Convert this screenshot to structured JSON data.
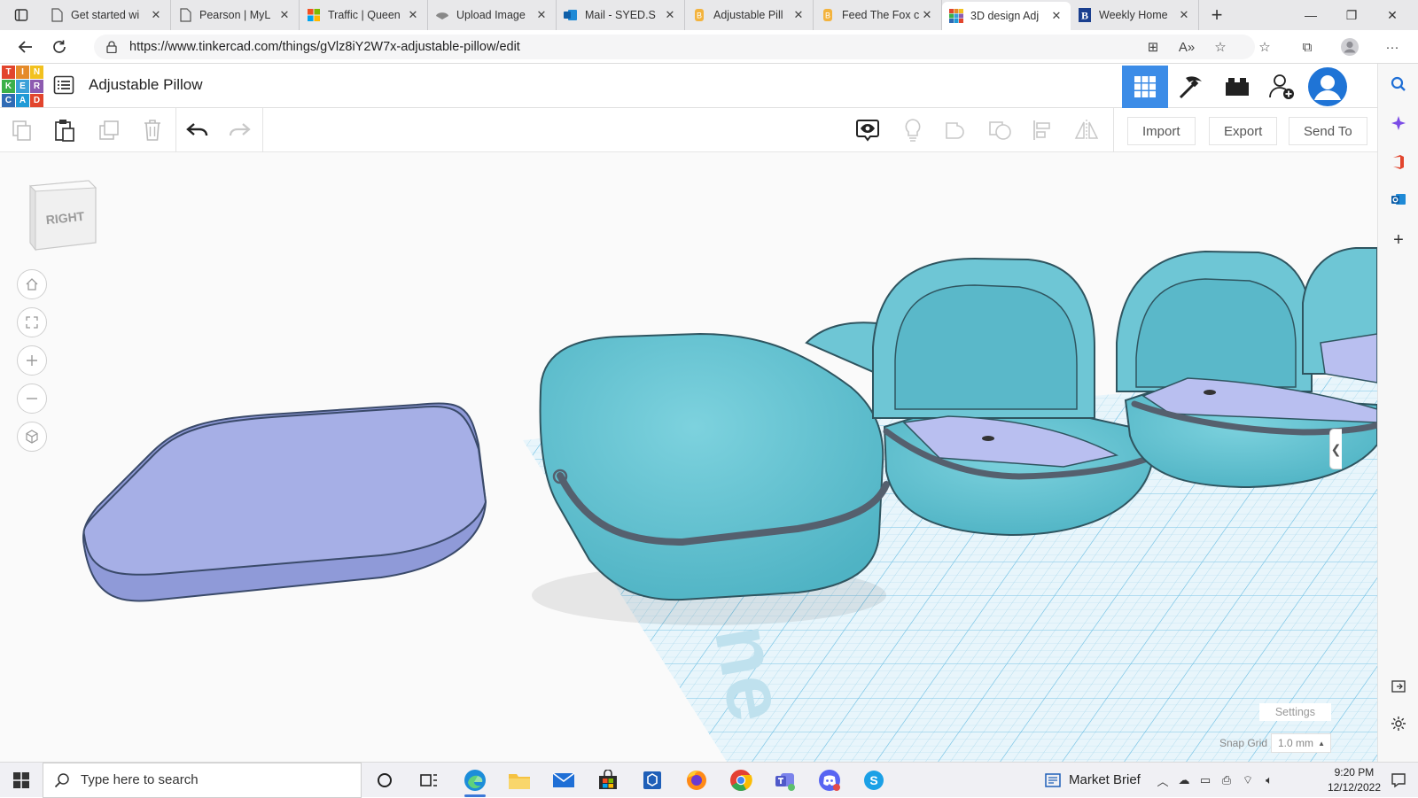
{
  "browser": {
    "tabs": [
      {
        "title": "Get started wi",
        "icon": "document-icon"
      },
      {
        "title": "Pearson | MyL",
        "icon": "document-icon"
      },
      {
        "title": "Traffic | Queen",
        "icon": "microsoft-icon"
      },
      {
        "title": "Upload Image",
        "icon": "upload-icon"
      },
      {
        "title": "Mail - SYED.S",
        "icon": "outlook-icon"
      },
      {
        "title": "Adjustable Pill",
        "icon": "bookmark-icon"
      },
      {
        "title": "Feed The Fox c",
        "icon": "bookmark-icon"
      },
      {
        "title": "3D design Adj",
        "icon": "tinkercad-icon",
        "active": true
      },
      {
        "title": "Weekly Home",
        "icon": "b-icon"
      }
    ],
    "tab_close": "✕",
    "new_tab": "+",
    "url": "https://www.tinkercad.com/things/gVlz8iY2W7x-adjustable-pillow/edit"
  },
  "app": {
    "logo_letters": [
      "T",
      "I",
      "N",
      "K",
      "E",
      "R",
      "C",
      "A",
      "D"
    ],
    "logo_colors": [
      "#e2452d",
      "#e58b2a",
      "#f2c11f",
      "#3bb04a",
      "#3aa0d8",
      "#8d5bb0",
      "#2f6bb5",
      "#1f9ad6",
      "#e2452d"
    ],
    "design_title": "Adjustable Pillow",
    "accent": "#3c8ce7"
  },
  "toolbar": {
    "import_label": "Import",
    "export_label": "Export",
    "send_to_label": "Send To"
  },
  "workplane": {
    "viewcube_face": "RIGHT",
    "settings_label": "Settings",
    "snap_grid_label": "Snap Grid",
    "snap_grid_value": "1.0 mm"
  },
  "taskbar": {
    "search_placeholder": "Type here to search",
    "market_brief": "Market Brief",
    "time": "9:20 PM",
    "date": "12/12/2022"
  }
}
